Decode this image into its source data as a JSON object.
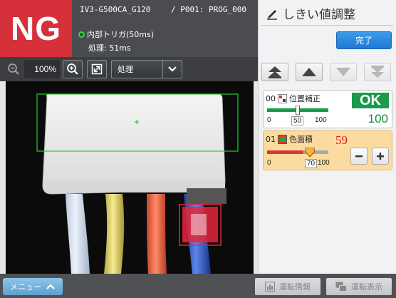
{
  "header": {
    "result": "NG",
    "device": "IV3-G500CA_G120",
    "program": "/ P001: PROG_000",
    "trigger": "内部トリガ(50ms)",
    "process_time": "処理: 51ms"
  },
  "toolbar": {
    "zoom": "100%",
    "view_select": "処理"
  },
  "panel": {
    "title": "しきい値調整",
    "done_label": "完了",
    "tools": [
      {
        "id": "00",
        "name": "位置補正",
        "status": "OK",
        "value": "100",
        "tick_min": "0",
        "tick_mid": "50",
        "tick_max": "100",
        "threshold": 50,
        "value_ratio": 1.0
      },
      {
        "id": "01",
        "name": "色面積",
        "value": "59",
        "tick_min": "0",
        "tick_mid": "70",
        "tick_max": "100",
        "threshold": 70,
        "value_ratio": 0.59
      }
    ]
  },
  "bottom": {
    "menu_label": "メニュー",
    "run_info_label": "運転情報",
    "run_display_label": "運転表示"
  },
  "colors": {
    "ng": "#d6303a",
    "ok": "#1a9a4a",
    "accent": "#1f79d6",
    "tool_selected_bg": "#fcdba0"
  }
}
